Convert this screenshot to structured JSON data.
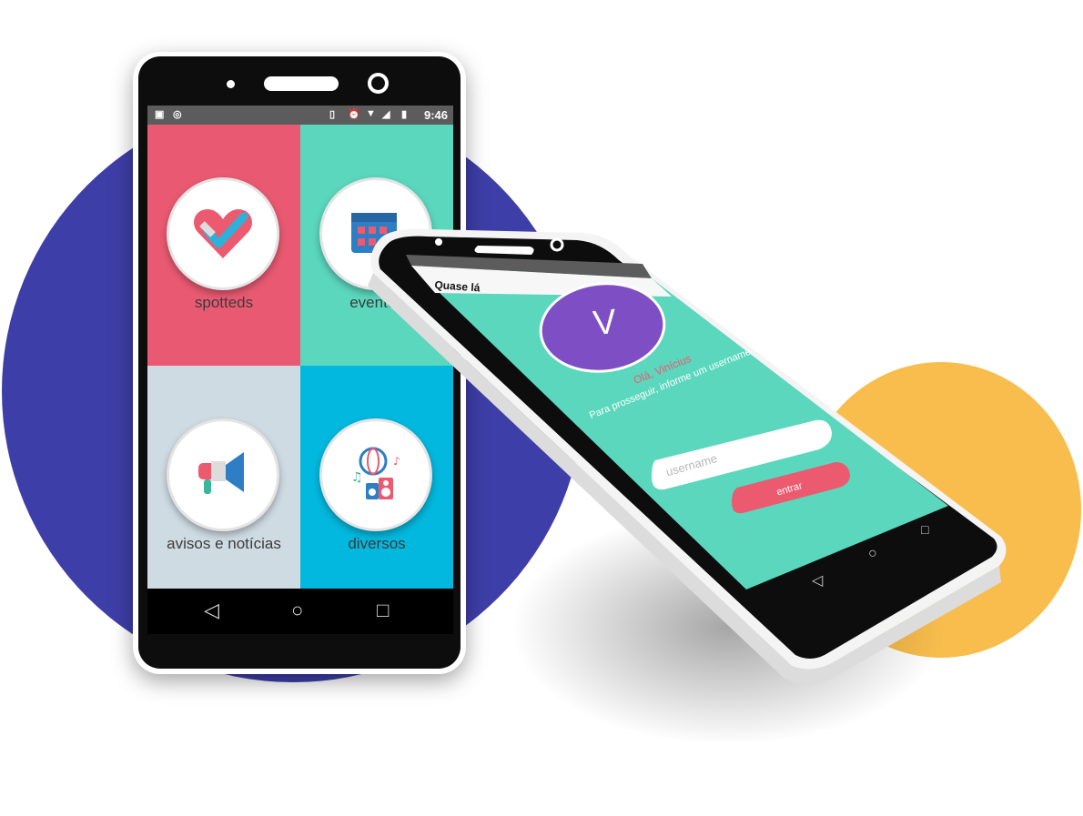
{
  "left_phone": {
    "status_time": "9:46",
    "tiles": [
      {
        "label": "spotteds",
        "color": "#e95a72"
      },
      {
        "label": "eventos",
        "color": "#5bd7bd"
      },
      {
        "label": "avisos e notícias",
        "color": "#cfdbe3"
      },
      {
        "label": "diversos",
        "color": "#03b8de"
      }
    ]
  },
  "right_phone": {
    "app_bar_title": "Quase lá",
    "avatar_letter": "V",
    "greeting": "Olá, Vinícius",
    "instruction": "Para prosseguir, informe um username",
    "username_placeholder": "username",
    "enter_button": "entrar",
    "accent_color": "#5bd7bd",
    "avatar_color": "#7e4fc4",
    "button_color": "#ec5a70"
  },
  "colors": {
    "blue_blob": "#3e3ea8",
    "yellow_blob": "#f8bd4c"
  }
}
